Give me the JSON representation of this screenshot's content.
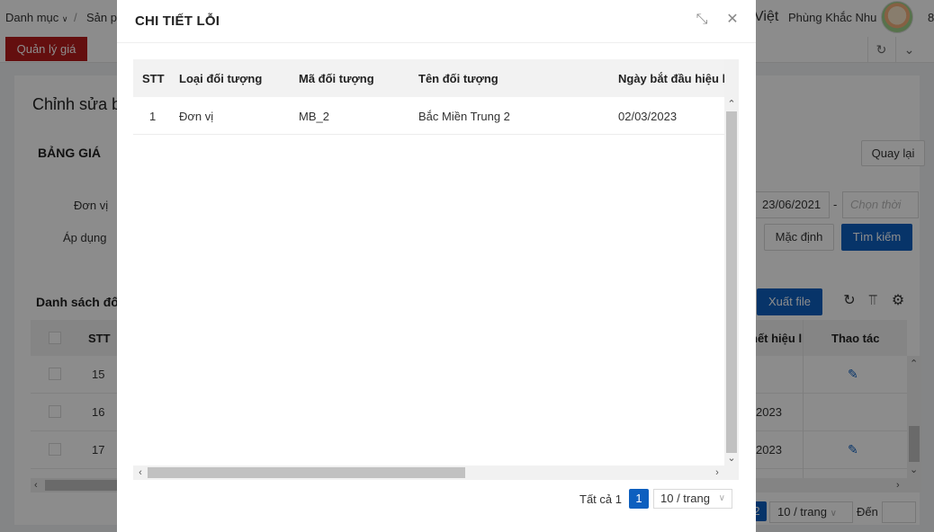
{
  "background": {
    "breadcrumb": {
      "item1": "Danh mục",
      "sep": "/",
      "item2": "Sản pl"
    },
    "language": "Việt",
    "user_name": "Phùng Khắc Nhu",
    "user_extra": "8",
    "active_tab": "Quản lý giá",
    "page_title": "Chỉnh sửa b",
    "section_title": "BẢNG GIÁ",
    "back_button": "Quay lại",
    "form": {
      "unit_label": "Đơn vị",
      "apply_label": "Áp dụng",
      "date_from": "23/06/2021",
      "date_to_placeholder": "Chọn thời",
      "date_dash": "-",
      "default_button": "Mặc định",
      "search_button": "Tìm kiếm"
    },
    "list_title": "Danh sách đố",
    "export_button": "Xuất file",
    "table": {
      "headers": {
        "stt": "STT",
        "effective_end": "hết hiệu l",
        "action": "Thao tác"
      },
      "rows": [
        {
          "stt": "15",
          "date": "",
          "editable": true
        },
        {
          "stt": "16",
          "date": "2023",
          "editable": false
        },
        {
          "stt": "17",
          "date": "2023",
          "editable": true
        }
      ]
    },
    "pagination": {
      "current_page": "2",
      "page_size": "10 / trang",
      "goto_label": "Đến"
    }
  },
  "modal": {
    "title": "CHI TIẾT LỖI",
    "table": {
      "headers": {
        "stt": "STT",
        "object_type": "Loại đối tượng",
        "object_code": "Mã đối tượng",
        "object_name": "Tên đối tượng",
        "start_date": "Ngày bắt đầu hiệu l"
      },
      "rows": [
        {
          "stt": "1",
          "object_type": "Đơn vị",
          "object_code": "MB_2",
          "object_name": "Bắc Miền Trung 2",
          "start_date": "02/03/2023"
        }
      ]
    },
    "pagination": {
      "total": "Tất cả 1",
      "current_page": "1",
      "page_size": "10 / trang"
    }
  },
  "colors": {
    "primary": "#0d5fbf",
    "tab_active": "#b71c1c",
    "overlay": "rgba(0,0,0,0.45)"
  }
}
